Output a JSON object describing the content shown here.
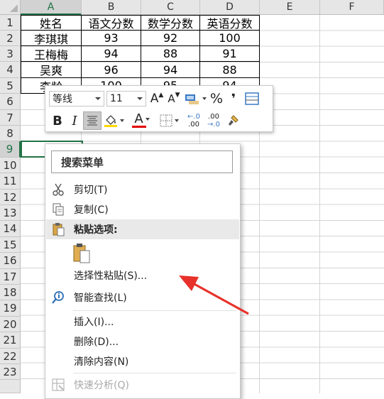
{
  "columns": [
    "A",
    "B",
    "C",
    "D",
    "E",
    "F"
  ],
  "rows": [
    "1",
    "2",
    "3",
    "4",
    "5",
    "6",
    "7",
    "8",
    "9",
    "10",
    "11",
    "12",
    "13",
    "14",
    "15",
    "16",
    "17",
    "18",
    "19",
    "20",
    "21",
    "22",
    "23"
  ],
  "table": {
    "header": [
      "姓名",
      "语文分数",
      "数学分数",
      "英语分数"
    ],
    "data": [
      [
        "李琪琪",
        "93",
        "92",
        "100"
      ],
      [
        "王梅梅",
        "94",
        "88",
        "91"
      ],
      [
        "吴爽",
        "96",
        "94",
        "88"
      ],
      [
        "李龄",
        "100",
        "95",
        "94"
      ]
    ]
  },
  "mini_toolbar": {
    "font_name": "等线",
    "font_size": "11",
    "grow_font": "A",
    "shrink_font": "A",
    "percent": "%",
    "comma": "❜",
    "bold": "B",
    "italic": "I",
    "font_color_letter": "A",
    "inc_decimal_top": "←.0",
    "inc_decimal_bottom": ".00",
    "dec_decimal_top": ".00",
    "dec_decimal_bottom": "→.0"
  },
  "context_menu": {
    "search_label": "搜索菜单",
    "items": {
      "cut": "剪切(T)",
      "copy": "复制(C)",
      "paste_options": "粘贴选项:",
      "paste_special": "选择性粘贴(S)...",
      "smart_lookup": "智能查找(L)",
      "insert": "插入(I)...",
      "delete": "删除(D)...",
      "clear": "清除内容(N)",
      "quick_analysis": "快速分析(Q)"
    }
  },
  "icons": {
    "cut": "scissors-icon",
    "copy": "copy-icon",
    "paste": "clipboard-icon",
    "smart_lookup": "lookup-icon",
    "quick_analysis": "quick-analysis-icon"
  },
  "colors": {
    "accent": "#217346",
    "font_color": "#e00000",
    "annotation_arrow": "#e8312a",
    "fill_color": "#ffd800"
  }
}
